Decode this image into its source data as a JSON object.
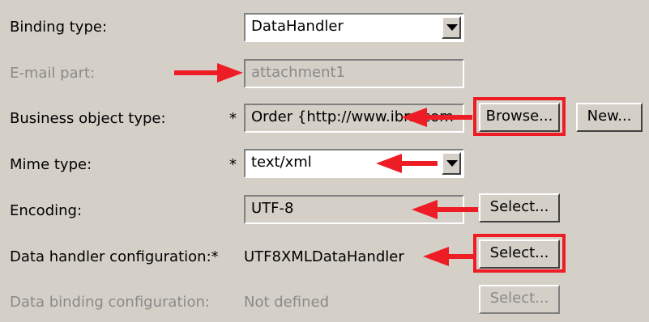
{
  "binding_type": {
    "label": "Binding type:",
    "value": "DataHandler"
  },
  "email_part": {
    "label": "E-mail part:",
    "value": "attachment1"
  },
  "business_object_type": {
    "label": "Business object type:",
    "required": "*",
    "value": "Order  {http://www.ibm.com",
    "browse_label": "Browse...",
    "new_label": "New..."
  },
  "mime_type": {
    "label": "Mime type:",
    "required": "*",
    "value": "text/xml"
  },
  "encoding": {
    "label": "Encoding:",
    "value": "UTF-8",
    "select_label": "Select..."
  },
  "data_handler_configuration": {
    "label": "Data handler configuration:*",
    "value": "UTF8XMLDataHandler",
    "select_label": "Select..."
  },
  "data_binding_configuration": {
    "label": "Data binding configuration:",
    "value": "Not defined",
    "select_label": "Select..."
  },
  "colors": {
    "highlight": "#ee1c25",
    "background": "#d4d0c8"
  },
  "icons": {
    "dropdown": "chevron-down-icon",
    "annotation": "red-arrow-icon"
  }
}
